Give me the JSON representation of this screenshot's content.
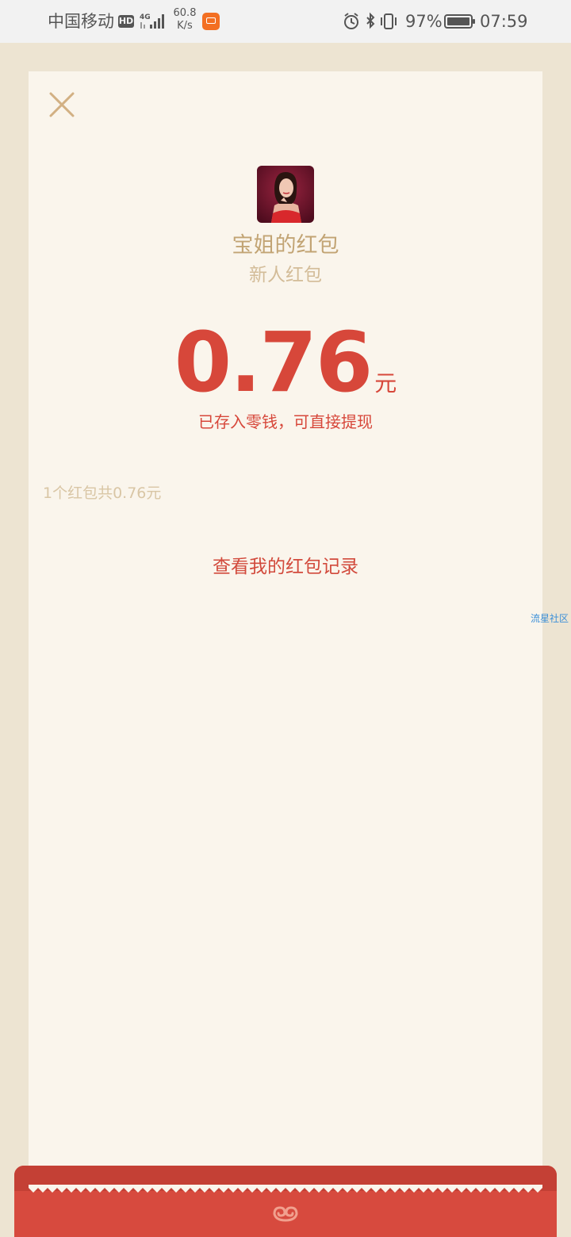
{
  "status_bar": {
    "carrier": "中国移动",
    "hd_badge": "HD",
    "network": "4G",
    "speed_value": "60.8",
    "speed_unit": "K/s",
    "battery_percent": "97%",
    "time": "07:59",
    "icons": [
      "hd-icon",
      "signal-icon",
      "mi-app-icon",
      "alarm-icon",
      "bluetooth-icon",
      "vibrate-icon",
      "battery-icon"
    ]
  },
  "card": {
    "close_icon": "close-icon",
    "sender_title": "宝姐的红包",
    "packet_desc": "新人红包",
    "amount": "0.76",
    "amount_unit": "元",
    "stored_note": "已存入零钱，可直接提现",
    "packet_summary": "1个红包共0.76元",
    "records_link": "查看我的红包记录"
  },
  "watermark": "流星社区",
  "colors": {
    "page_bg": "#ede4d2",
    "card_bg": "#faf5ec",
    "accent_red": "#d7473a",
    "gold_text": "#c2a474",
    "light_gold": "#d3bc98"
  }
}
